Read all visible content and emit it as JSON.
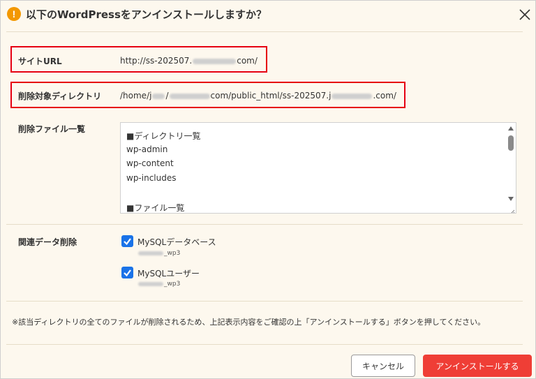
{
  "dialog": {
    "title": "以下のWordPressをアンインストールしますか？",
    "warn_icon_glyph": "!"
  },
  "site_url": {
    "label": "サイトURL",
    "value_prefix": "http://ss-202507.",
    "value_suffix": "com/"
  },
  "delete_dir": {
    "label": "削除対象ディレクトリ",
    "value_prefix": "/home/j",
    "value_mid": "/",
    "value_mid2": "com/public_html/ss-202507.j",
    "value_suffix": ".com/"
  },
  "file_list": {
    "label": "削除ファイル一覧",
    "lines": [
      "■ディレクトリ一覧",
      "wp-admin",
      "wp-content",
      "wp-includes",
      "",
      "■ファイル一覧"
    ]
  },
  "related": {
    "label": "関連データ削除",
    "db_label": "MySQLデータベース",
    "db_sub": "_wp3",
    "user_label": "MySQLユーザー",
    "user_sub": "_wp3",
    "db_checked": true,
    "user_checked": true
  },
  "note": "※該当ディレクトリの全てのファイルが削除されるため、上記表示内容をご確認の上「アンインストールする」ボタンを押してください。",
  "buttons": {
    "cancel": "キャンセル",
    "uninstall": "アンインストールする"
  },
  "colors": {
    "accent_red": "#ef3e36",
    "highlight_red": "#e60012",
    "warning_orange": "#f39800",
    "checkbox_blue": "#1a73e8"
  }
}
